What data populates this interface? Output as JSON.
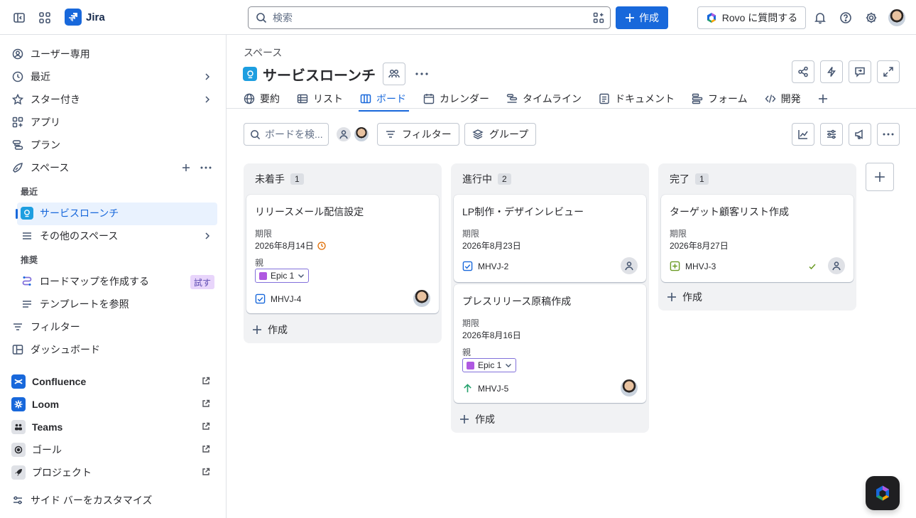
{
  "topbar": {
    "brand": "Jira",
    "search_placeholder": "検索",
    "create_label": "作成",
    "rovo_label": "Rovo に質問する",
    "icons": [
      "sidebar-toggle-icon",
      "app-switcher-icon",
      "jira-logo-icon",
      "search-icon",
      "search-filter-icon",
      "plus-icon",
      "rovo-icon",
      "bell-icon",
      "help-icon",
      "gear-icon"
    ]
  },
  "sidebar": {
    "items": [
      {
        "label": "ユーザー専用",
        "icon": "user-circle-icon"
      },
      {
        "label": "最近",
        "icon": "clock-icon"
      },
      {
        "label": "スター付き",
        "icon": "star-icon"
      },
      {
        "label": "アプリ",
        "icon": "apps-icon"
      },
      {
        "label": "プラン",
        "icon": "plans-icon"
      },
      {
        "label": "スペース",
        "icon": "spaces-icon"
      }
    ],
    "recent_heading": "最近",
    "active_space": "サービスローンチ",
    "other_spaces": "その他のスペース",
    "recommended_heading": "推奨",
    "roadmap_label": "ロードマップを作成する",
    "try_badge": "試す",
    "templates_label": "テンプレートを参照",
    "filters_label": "フィルター",
    "dashboards_label": "ダッシュボード",
    "apps": [
      {
        "label": "Confluence",
        "color": "#1868db"
      },
      {
        "label": "Loom",
        "color": "#1868db"
      },
      {
        "label": "Teams",
        "color": "#44546f"
      },
      {
        "label": "ゴール",
        "color": "#44546f"
      },
      {
        "label": "プロジェクト",
        "color": "#44546f"
      }
    ],
    "customize_label": "サイド バーをカスタマイズ"
  },
  "main": {
    "breadcrumb": "スペース",
    "title": "サービスローンチ",
    "tabs": [
      {
        "label": "要約",
        "icon": "globe-icon"
      },
      {
        "label": "リスト",
        "icon": "list-icon"
      },
      {
        "label": "ボード",
        "icon": "board-icon",
        "active": true
      },
      {
        "label": "カレンダー",
        "icon": "calendar-icon"
      },
      {
        "label": "タイムライン",
        "icon": "timeline-icon"
      },
      {
        "label": "ドキュメント",
        "icon": "document-icon"
      },
      {
        "label": "フォーム",
        "icon": "form-icon"
      },
      {
        "label": "開発",
        "icon": "code-icon"
      }
    ],
    "board_search_placeholder": "ボードを検...",
    "filter_label": "フィルター",
    "group_label": "グループ"
  },
  "board": {
    "columns": [
      {
        "name": "未着手",
        "count": "1",
        "cards": [
          {
            "title": "リリースメール配信設定",
            "due_label": "期限",
            "due": "2026年8月14日",
            "parent_label": "親",
            "epic": "Epic 1",
            "key": "MHVJ-4"
          }
        ],
        "create_label": "作成"
      },
      {
        "name": "進行中",
        "count": "2",
        "cards": [
          {
            "title": "LP制作・デザインレビュー",
            "due_label": "期限",
            "due": "2026年8月23日",
            "key": "MHVJ-2"
          },
          {
            "title": "プレスリリース原稿作成",
            "due_label": "期限",
            "due": "2026年8月16日",
            "parent_label": "親",
            "epic": "Epic 1",
            "key": "MHVJ-5"
          }
        ],
        "create_label": "作成"
      },
      {
        "name": "完了",
        "count": "1",
        "cards": [
          {
            "title": "ターゲット顧客リスト作成",
            "due_label": "期限",
            "due": "2026年8月27日",
            "key": "MHVJ-3"
          }
        ],
        "create_label": "作成"
      }
    ]
  },
  "colors": {
    "accent": "#1868db",
    "epic": "#af59e1",
    "selected_bg": "#e9f2fe"
  }
}
